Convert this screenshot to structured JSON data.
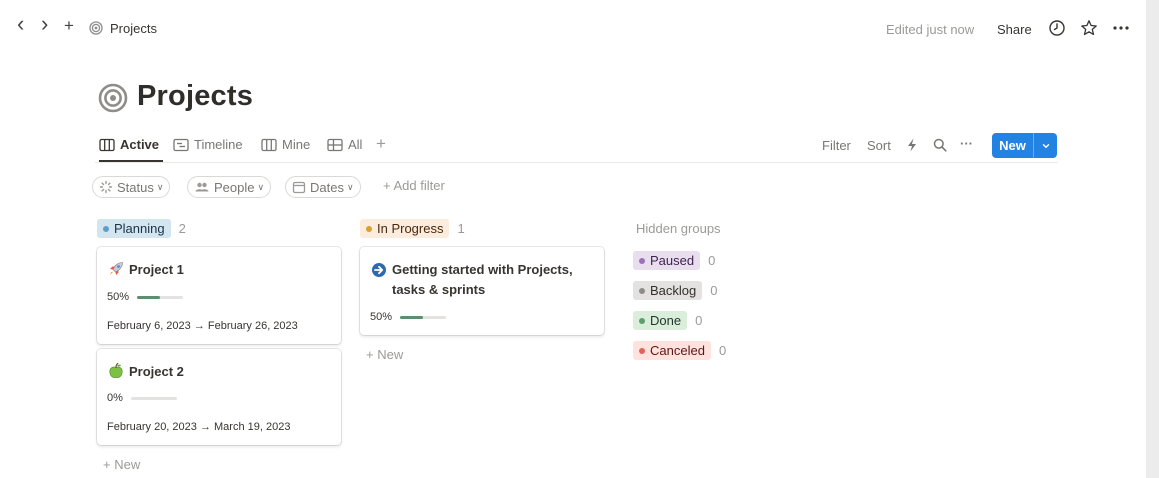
{
  "topbar": {
    "back_glyph": "‹",
    "forward_glyph": "›",
    "add_glyph": "+",
    "breadcrumb": "Projects",
    "edited": "Edited just now",
    "share": "Share",
    "icons": [
      "clock-icon",
      "star-icon",
      "more-icon"
    ]
  },
  "page": {
    "title": "Projects",
    "icon": "target-icon"
  },
  "tabs": [
    {
      "label": "Active",
      "icon": "board-icon"
    },
    {
      "label": "Timeline",
      "icon": "timeline-icon"
    },
    {
      "label": "Mine",
      "icon": "board-icon"
    },
    {
      "label": "All",
      "icon": "table-icon"
    }
  ],
  "add_view_glyph": "+",
  "toolbar": {
    "filter": "Filter",
    "sort": "Sort",
    "more_glyph": "···",
    "new_label": "New"
  },
  "filters": {
    "status": "Status",
    "people": "People",
    "dates": "Dates",
    "add_filter": "+ Add filter"
  },
  "groups": [
    {
      "name": "Planning",
      "count": "2",
      "color": "#d3e5ef",
      "dot": "#5e9fca",
      "cards": [
        {
          "title": "Project 1",
          "emoji": "rocket",
          "progress_label": "50%",
          "progress": 0.5,
          "dates": "February 6, 2023 → February 26, 2023"
        },
        {
          "title": "Project 2",
          "emoji": "apple",
          "progress_label": "0%",
          "progress": 0.0,
          "dates": "February 20, 2023 → March 19, 2023"
        }
      ]
    },
    {
      "name": "In Progress",
      "count": "1",
      "color": "#fbecdd",
      "dot": "#d9a030",
      "cards": [
        {
          "title": "Getting started with Projects,",
          "title_line2": "tasks & sprints",
          "emoji": "arrow-circle-right",
          "progress_label": "50%",
          "progress": 0.5
        }
      ]
    }
  ],
  "new_item": "+ New",
  "hidden_groups": {
    "label": "Hidden groups",
    "items": [
      {
        "name": "Paused",
        "count": "0",
        "bg": "#e8deee",
        "dot": "#9b72b8"
      },
      {
        "name": "Backlog",
        "count": "0",
        "bg": "#e3e2e0",
        "dot": "#8d8c89"
      },
      {
        "name": "Done",
        "count": "0",
        "bg": "#dbeddb",
        "dot": "#5c9f6c"
      },
      {
        "name": "Canceled",
        "count": "0",
        "bg": "#ffe2dd",
        "dot": "#e06458"
      }
    ]
  }
}
